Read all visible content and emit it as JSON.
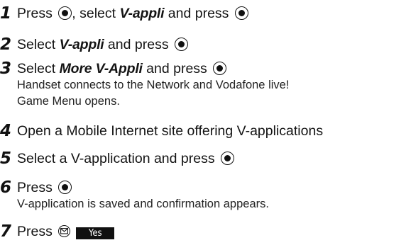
{
  "steps": [
    {
      "number": "1",
      "segments": [
        "Press ",
        ", select ",
        "V-appli",
        " and press "
      ]
    },
    {
      "number": "2",
      "segments": [
        "Select ",
        "V-appli",
        " and press "
      ]
    },
    {
      "number": "3",
      "segments": [
        "Select ",
        "More V-Appli",
        " and press "
      ],
      "detail_lines": [
        "Handset connects to the Network and Vodafone live!",
        "Game Menu opens."
      ]
    },
    {
      "number": "4",
      "text": "Open a Mobile Internet site offering V-applications"
    },
    {
      "number": "5",
      "segments": [
        "Select a V-application and press "
      ]
    },
    {
      "number": "6",
      "segments": [
        "Press "
      ],
      "detail_lines": [
        "V-application is saved and confirmation appears."
      ]
    },
    {
      "number": "7",
      "segments": [
        "Press "
      ],
      "softkey_label": "Yes"
    }
  ],
  "icons": {
    "center_key": "center-select-key-icon",
    "mail_key": "mail-key-icon"
  }
}
